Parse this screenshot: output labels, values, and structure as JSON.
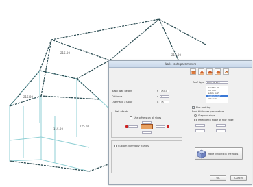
{
  "colors": {
    "frame_line": "#2f4f55",
    "glass_line": "#7fc6cc",
    "dialog_bg": "#f0f0f0",
    "selection": "#3a78d6",
    "accent_red": "#cc2222"
  },
  "dimensions": {
    "left_label": "215.00",
    "bottom_left_label": "215.00",
    "middle_label": "115.00",
    "lower_middle_label": "125.00",
    "right_top_label": "213.00"
  },
  "dialog": {
    "title": "Walls roofs parameters",
    "left_fields": [
      {
        "label": "Basic wall height",
        "prefix": "h",
        "value": "250.0"
      },
      {
        "label": "Distance",
        "prefix": "d",
        "value": "0"
      },
      {
        "label": "Overhang / Slope",
        "prefix": "α",
        "value": "45"
      }
    ],
    "right_top": {
      "label": "Roof type",
      "field": "Roof for all..."
    },
    "roof_list": {
      "items": [
        "Roof for all...",
        "Hip roof",
        "Gable roof",
        "Custom roof",
        "Flat roof"
      ],
      "selected_index": 3
    },
    "offsets_group": {
      "title": "Wall offsets",
      "checkbox_label": "Use offsets on all sides"
    },
    "bottom_group": {
      "checkbox_label": "Custom dormitory frames"
    },
    "flat_section": {
      "checkbox_label": "Flat roof top",
      "subtitle": "Roof thickness parameters",
      "option1": "Stepped slope",
      "option2": "Relative to slope of roof edge"
    },
    "action_button": "Make cutouts in the roofs",
    "ok_label": "OK",
    "cancel_label": "Cancel"
  }
}
